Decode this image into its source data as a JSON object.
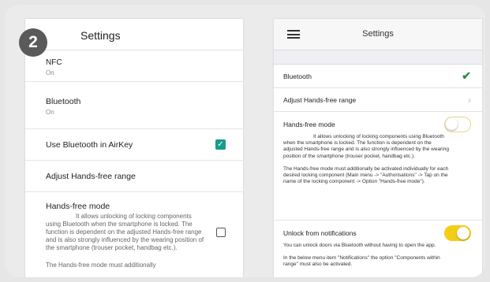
{
  "step": "2",
  "android": {
    "title": "Settings",
    "nfc": {
      "label": "NFC",
      "value": "On"
    },
    "bluetooth": {
      "label": "Bluetooth",
      "value": "On"
    },
    "use_bluetooth": {
      "label": "Use Bluetooth in AirKey",
      "checked": true
    },
    "adjust_range": {
      "label": "Adjust Hands-free range"
    },
    "hands_free": {
      "label": "Hands-free mode",
      "description": "It allows unlocking of locking components using Bluetooth when the smartphone is locked. The function is dependent on the adjusted Hands-free range and is also strongly influenced by the wearing position of the smartphone (trouser pocket, handbag etc.).",
      "description2": "The Hands-free mode must additionally",
      "checked": false
    }
  },
  "ios": {
    "title": "Settings",
    "bluetooth": {
      "label": "Bluetooth",
      "enabled": true
    },
    "adjust_range": {
      "label": "Adjust Hands-free range"
    },
    "hands_free": {
      "label": "Hands-free mode",
      "description": "It allows unlocking of locking components using Bluetooth when the smartphone is locked. The function is dependent on the adjusted Hands-free range and is also strongly influenced by the wearing position of the smartphone (trouser pocket, handbag etc.).",
      "description2": "The Hands-free mode must additionally be activated individually for each desired locking component (Main menu -> \"Authorisations\" -> Tap on the name of the locking component -> Option \"Hands-free mode\").",
      "enabled": false
    },
    "unlock_notifications": {
      "label": "Unlock from notifications",
      "description": "You can unlock doors via Bluetooth without having to open the app.",
      "description2": "In the below menu item \"Notifications\" the option \"Components within range\" must also be activated.",
      "enabled": true
    }
  },
  "colors": {
    "checkbox": "#1a9b8a",
    "checkmark": "#2e8b3d",
    "toggle_on": "#f3ce16",
    "badge": "#5a5a5a"
  }
}
